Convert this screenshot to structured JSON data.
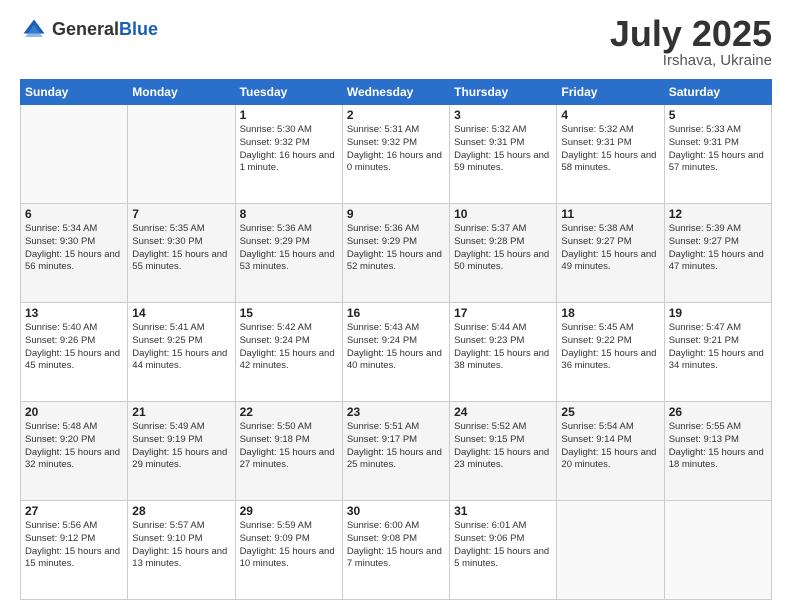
{
  "logo": {
    "general": "General",
    "blue": "Blue"
  },
  "header": {
    "month": "July 2025",
    "location": "Irshava, Ukraine"
  },
  "weekdays": [
    "Sunday",
    "Monday",
    "Tuesday",
    "Wednesday",
    "Thursday",
    "Friday",
    "Saturday"
  ],
  "weeks": [
    [
      {
        "day": "",
        "info": ""
      },
      {
        "day": "",
        "info": ""
      },
      {
        "day": "1",
        "info": "Sunrise: 5:30 AM\nSunset: 9:32 PM\nDaylight: 16 hours\nand 1 minute."
      },
      {
        "day": "2",
        "info": "Sunrise: 5:31 AM\nSunset: 9:32 PM\nDaylight: 16 hours\nand 0 minutes."
      },
      {
        "day": "3",
        "info": "Sunrise: 5:32 AM\nSunset: 9:31 PM\nDaylight: 15 hours\nand 59 minutes."
      },
      {
        "day": "4",
        "info": "Sunrise: 5:32 AM\nSunset: 9:31 PM\nDaylight: 15 hours\nand 58 minutes."
      },
      {
        "day": "5",
        "info": "Sunrise: 5:33 AM\nSunset: 9:31 PM\nDaylight: 15 hours\nand 57 minutes."
      }
    ],
    [
      {
        "day": "6",
        "info": "Sunrise: 5:34 AM\nSunset: 9:30 PM\nDaylight: 15 hours\nand 56 minutes."
      },
      {
        "day": "7",
        "info": "Sunrise: 5:35 AM\nSunset: 9:30 PM\nDaylight: 15 hours\nand 55 minutes."
      },
      {
        "day": "8",
        "info": "Sunrise: 5:36 AM\nSunset: 9:29 PM\nDaylight: 15 hours\nand 53 minutes."
      },
      {
        "day": "9",
        "info": "Sunrise: 5:36 AM\nSunset: 9:29 PM\nDaylight: 15 hours\nand 52 minutes."
      },
      {
        "day": "10",
        "info": "Sunrise: 5:37 AM\nSunset: 9:28 PM\nDaylight: 15 hours\nand 50 minutes."
      },
      {
        "day": "11",
        "info": "Sunrise: 5:38 AM\nSunset: 9:27 PM\nDaylight: 15 hours\nand 49 minutes."
      },
      {
        "day": "12",
        "info": "Sunrise: 5:39 AM\nSunset: 9:27 PM\nDaylight: 15 hours\nand 47 minutes."
      }
    ],
    [
      {
        "day": "13",
        "info": "Sunrise: 5:40 AM\nSunset: 9:26 PM\nDaylight: 15 hours\nand 45 minutes."
      },
      {
        "day": "14",
        "info": "Sunrise: 5:41 AM\nSunset: 9:25 PM\nDaylight: 15 hours\nand 44 minutes."
      },
      {
        "day": "15",
        "info": "Sunrise: 5:42 AM\nSunset: 9:24 PM\nDaylight: 15 hours\nand 42 minutes."
      },
      {
        "day": "16",
        "info": "Sunrise: 5:43 AM\nSunset: 9:24 PM\nDaylight: 15 hours\nand 40 minutes."
      },
      {
        "day": "17",
        "info": "Sunrise: 5:44 AM\nSunset: 9:23 PM\nDaylight: 15 hours\nand 38 minutes."
      },
      {
        "day": "18",
        "info": "Sunrise: 5:45 AM\nSunset: 9:22 PM\nDaylight: 15 hours\nand 36 minutes."
      },
      {
        "day": "19",
        "info": "Sunrise: 5:47 AM\nSunset: 9:21 PM\nDaylight: 15 hours\nand 34 minutes."
      }
    ],
    [
      {
        "day": "20",
        "info": "Sunrise: 5:48 AM\nSunset: 9:20 PM\nDaylight: 15 hours\nand 32 minutes."
      },
      {
        "day": "21",
        "info": "Sunrise: 5:49 AM\nSunset: 9:19 PM\nDaylight: 15 hours\nand 29 minutes."
      },
      {
        "day": "22",
        "info": "Sunrise: 5:50 AM\nSunset: 9:18 PM\nDaylight: 15 hours\nand 27 minutes."
      },
      {
        "day": "23",
        "info": "Sunrise: 5:51 AM\nSunset: 9:17 PM\nDaylight: 15 hours\nand 25 minutes."
      },
      {
        "day": "24",
        "info": "Sunrise: 5:52 AM\nSunset: 9:15 PM\nDaylight: 15 hours\nand 23 minutes."
      },
      {
        "day": "25",
        "info": "Sunrise: 5:54 AM\nSunset: 9:14 PM\nDaylight: 15 hours\nand 20 minutes."
      },
      {
        "day": "26",
        "info": "Sunrise: 5:55 AM\nSunset: 9:13 PM\nDaylight: 15 hours\nand 18 minutes."
      }
    ],
    [
      {
        "day": "27",
        "info": "Sunrise: 5:56 AM\nSunset: 9:12 PM\nDaylight: 15 hours\nand 15 minutes."
      },
      {
        "day": "28",
        "info": "Sunrise: 5:57 AM\nSunset: 9:10 PM\nDaylight: 15 hours\nand 13 minutes."
      },
      {
        "day": "29",
        "info": "Sunrise: 5:59 AM\nSunset: 9:09 PM\nDaylight: 15 hours\nand 10 minutes."
      },
      {
        "day": "30",
        "info": "Sunrise: 6:00 AM\nSunset: 9:08 PM\nDaylight: 15 hours\nand 7 minutes."
      },
      {
        "day": "31",
        "info": "Sunrise: 6:01 AM\nSunset: 9:06 PM\nDaylight: 15 hours\nand 5 minutes."
      },
      {
        "day": "",
        "info": ""
      },
      {
        "day": "",
        "info": ""
      }
    ]
  ]
}
